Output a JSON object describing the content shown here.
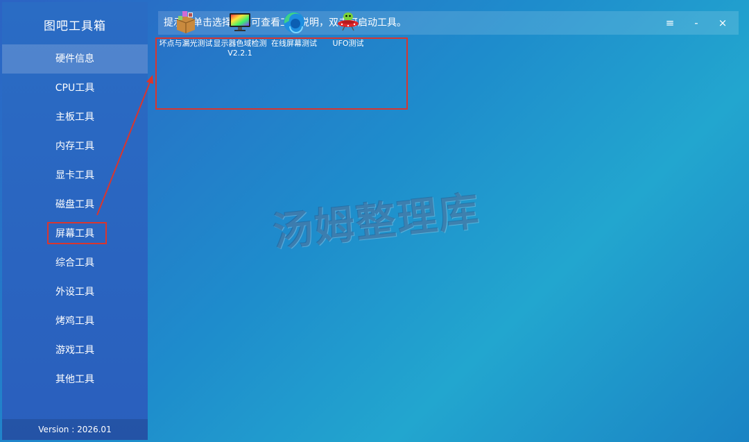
{
  "window": {
    "title": "图吧工具箱",
    "hint": "提示：单击选择工具可查看工具说明，双击可启动工具。",
    "menu_icon": "≡",
    "minimize_icon": "-",
    "close_icon": "×"
  },
  "sidebar": {
    "items": [
      {
        "label": "硬件信息"
      },
      {
        "label": "CPU工具"
      },
      {
        "label": "主板工具"
      },
      {
        "label": "内存工具"
      },
      {
        "label": "显卡工具"
      },
      {
        "label": "磁盘工具"
      },
      {
        "label": "屏幕工具"
      },
      {
        "label": "综合工具"
      },
      {
        "label": "外设工具"
      },
      {
        "label": "烤鸡工具"
      },
      {
        "label": "游戏工具"
      },
      {
        "label": "其他工具"
      }
    ],
    "version": "Version : 2026.01"
  },
  "tools": [
    {
      "label": "坏点与漏光测试",
      "icon": "box-icon"
    },
    {
      "label": "显示器色域检测V2.2.1",
      "icon": "monitor-icon"
    },
    {
      "label": "在线屏幕测试",
      "icon": "edge-browser-icon"
    },
    {
      "label": "UFO测试",
      "icon": "ufo-icon"
    }
  ],
  "watermark": "汤姆整理库",
  "colors": {
    "highlight": "#d9362e",
    "sidebar": "#2a66c2",
    "accent": "#22a6cf"
  }
}
